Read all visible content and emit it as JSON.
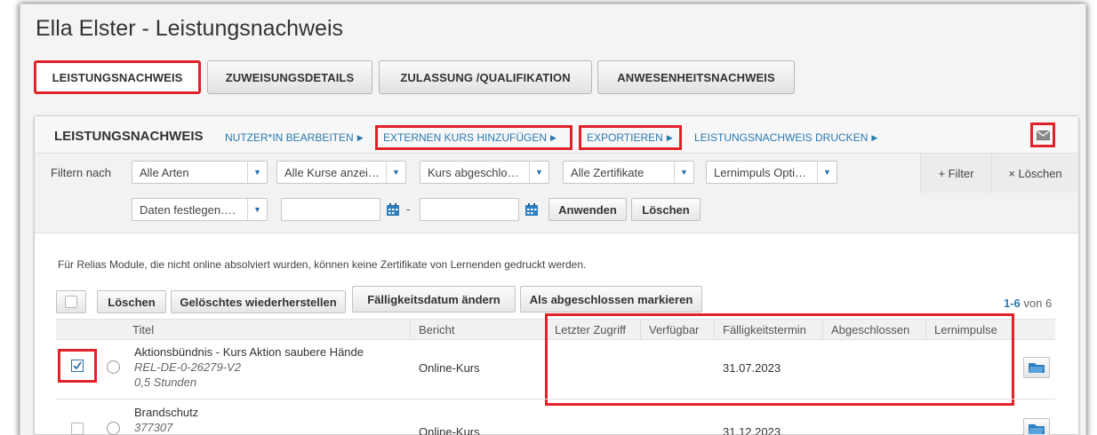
{
  "page": {
    "title": "Ella Elster - Leistungsnachweis"
  },
  "tabs": [
    {
      "label": "LEISTUNGSNACHWEIS",
      "active": true
    },
    {
      "label": "ZUWEISUNGSDETAILS",
      "active": false
    },
    {
      "label": "ZULASSUNG /QUALIFIKATION",
      "active": false
    },
    {
      "label": "ANWESENHEITSNACHWEIS",
      "active": false
    }
  ],
  "panel": {
    "title": "LEISTUNGSNACHWEIS",
    "links": [
      "NUTZER*IN BEARBEITEN",
      "EXTERNEN KURS HINZUFÜGEN",
      "EXPORTIEREN",
      "LEISTUNGSNACHWEIS DRUCKEN"
    ],
    "mail_icon": "envelope-icon"
  },
  "filters": {
    "label": "Filtern nach",
    "selects": [
      "Alle Arten",
      "Alle Kurse anzei…",
      "Kurs abgeschlo…",
      "Alle Zertifikate",
      "Lernimpuls Opti…"
    ],
    "date_select": "Daten festlegen….",
    "date_dash": "-",
    "apply_label": "Anwenden",
    "clear_label": "Löschen",
    "add_filter_label": "+ Filter",
    "remove_filter_label": "× Löschen"
  },
  "notice": "Für Relias Module, die nicht online absolviert wurden, können keine Zertifikate von Lernenden gedruckt werden.",
  "toolbar": {
    "delete_label": "Löschen",
    "restore_label": "Gelöschtes wiederherstellen",
    "due_label": "Fälligkeitsdatum ändern",
    "complete_label": "Als abgeschlossen markieren",
    "count_range": "1-6",
    "count_rest": " von 6"
  },
  "table": {
    "headers": [
      "Titel",
      "Bericht",
      "Letzter Zugriff",
      "Verfügbar",
      "Fälligkeitstermin",
      "Abgeschlossen",
      "Lernimpulse"
    ],
    "rows": [
      {
        "title": "Aktionsbündnis - Kurs Aktion saubere Hände",
        "code": "REL-DE-0-26279-V2",
        "duration": "0,5 Stunden",
        "report": "Online-Kurs",
        "due": "31.07.2023",
        "checked": true
      },
      {
        "title": "Brandschutz",
        "code": "377307",
        "report": "Online-Kurs",
        "due": "31.12.2023",
        "checked": false
      }
    ]
  },
  "colors": {
    "highlight": "#e32128",
    "link": "#2a7ab0"
  }
}
